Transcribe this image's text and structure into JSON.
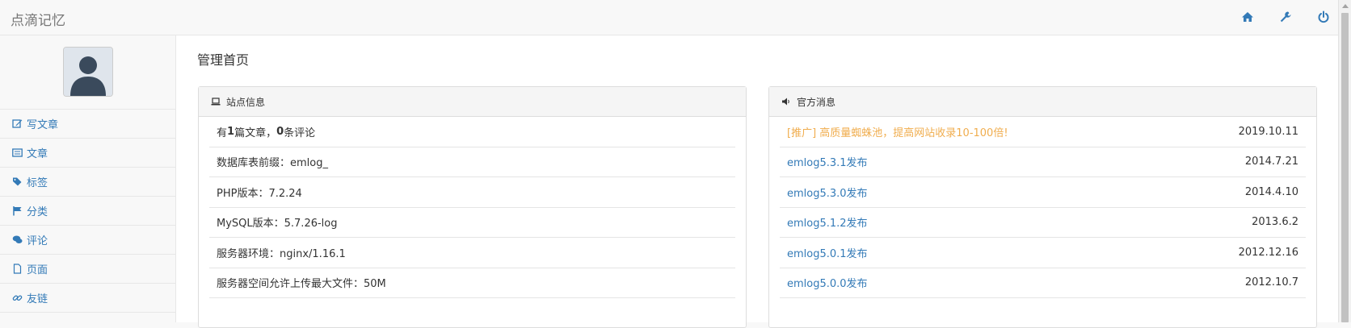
{
  "brand": "点滴记忆",
  "topbar": {
    "icons": [
      "home-icon",
      "wrench-icon",
      "power-icon"
    ]
  },
  "sidebar": {
    "items": [
      {
        "label": "写文章",
        "icon": "edit-icon"
      },
      {
        "label": "文章",
        "icon": "list-icon"
      },
      {
        "label": "标签",
        "icon": "tags-icon"
      },
      {
        "label": "分类",
        "icon": "flag-icon"
      },
      {
        "label": "评论",
        "icon": "comments-icon"
      },
      {
        "label": "页面",
        "icon": "file-icon"
      },
      {
        "label": "友链",
        "icon": "link-icon"
      }
    ]
  },
  "main": {
    "title": "管理首页",
    "site_info": {
      "heading": "站点信息",
      "stats_prefix": "有",
      "article_count": "1",
      "articles_suffix": "篇文章，",
      "comment_count": "0",
      "comments_suffix": "条评论",
      "rows": [
        "数据库表前缀：emlog_",
        "PHP版本：7.2.24",
        "MySQL版本：5.7.26-log",
        "服务器环境：nginx/1.16.1",
        "服务器空间允许上传最大文件：50M"
      ]
    },
    "news": {
      "heading": "官方消息",
      "items": [
        {
          "title": "[推广] 高质量蜘蛛池，提高网站收录10-100倍!",
          "date": "2019.10.11",
          "promo": true
        },
        {
          "title": "emlog5.3.1发布",
          "date": "2014.7.21"
        },
        {
          "title": "emlog5.3.0发布",
          "date": "2014.4.10"
        },
        {
          "title": "emlog5.1.2发布",
          "date": "2013.6.2"
        },
        {
          "title": "emlog5.0.1发布",
          "date": "2012.12.16"
        },
        {
          "title": "emlog5.0.0发布",
          "date": "2012.10.7"
        }
      ]
    }
  },
  "colors": {
    "link": "#337ab7",
    "promo": "#f0ad4e",
    "brand": "#777777"
  }
}
